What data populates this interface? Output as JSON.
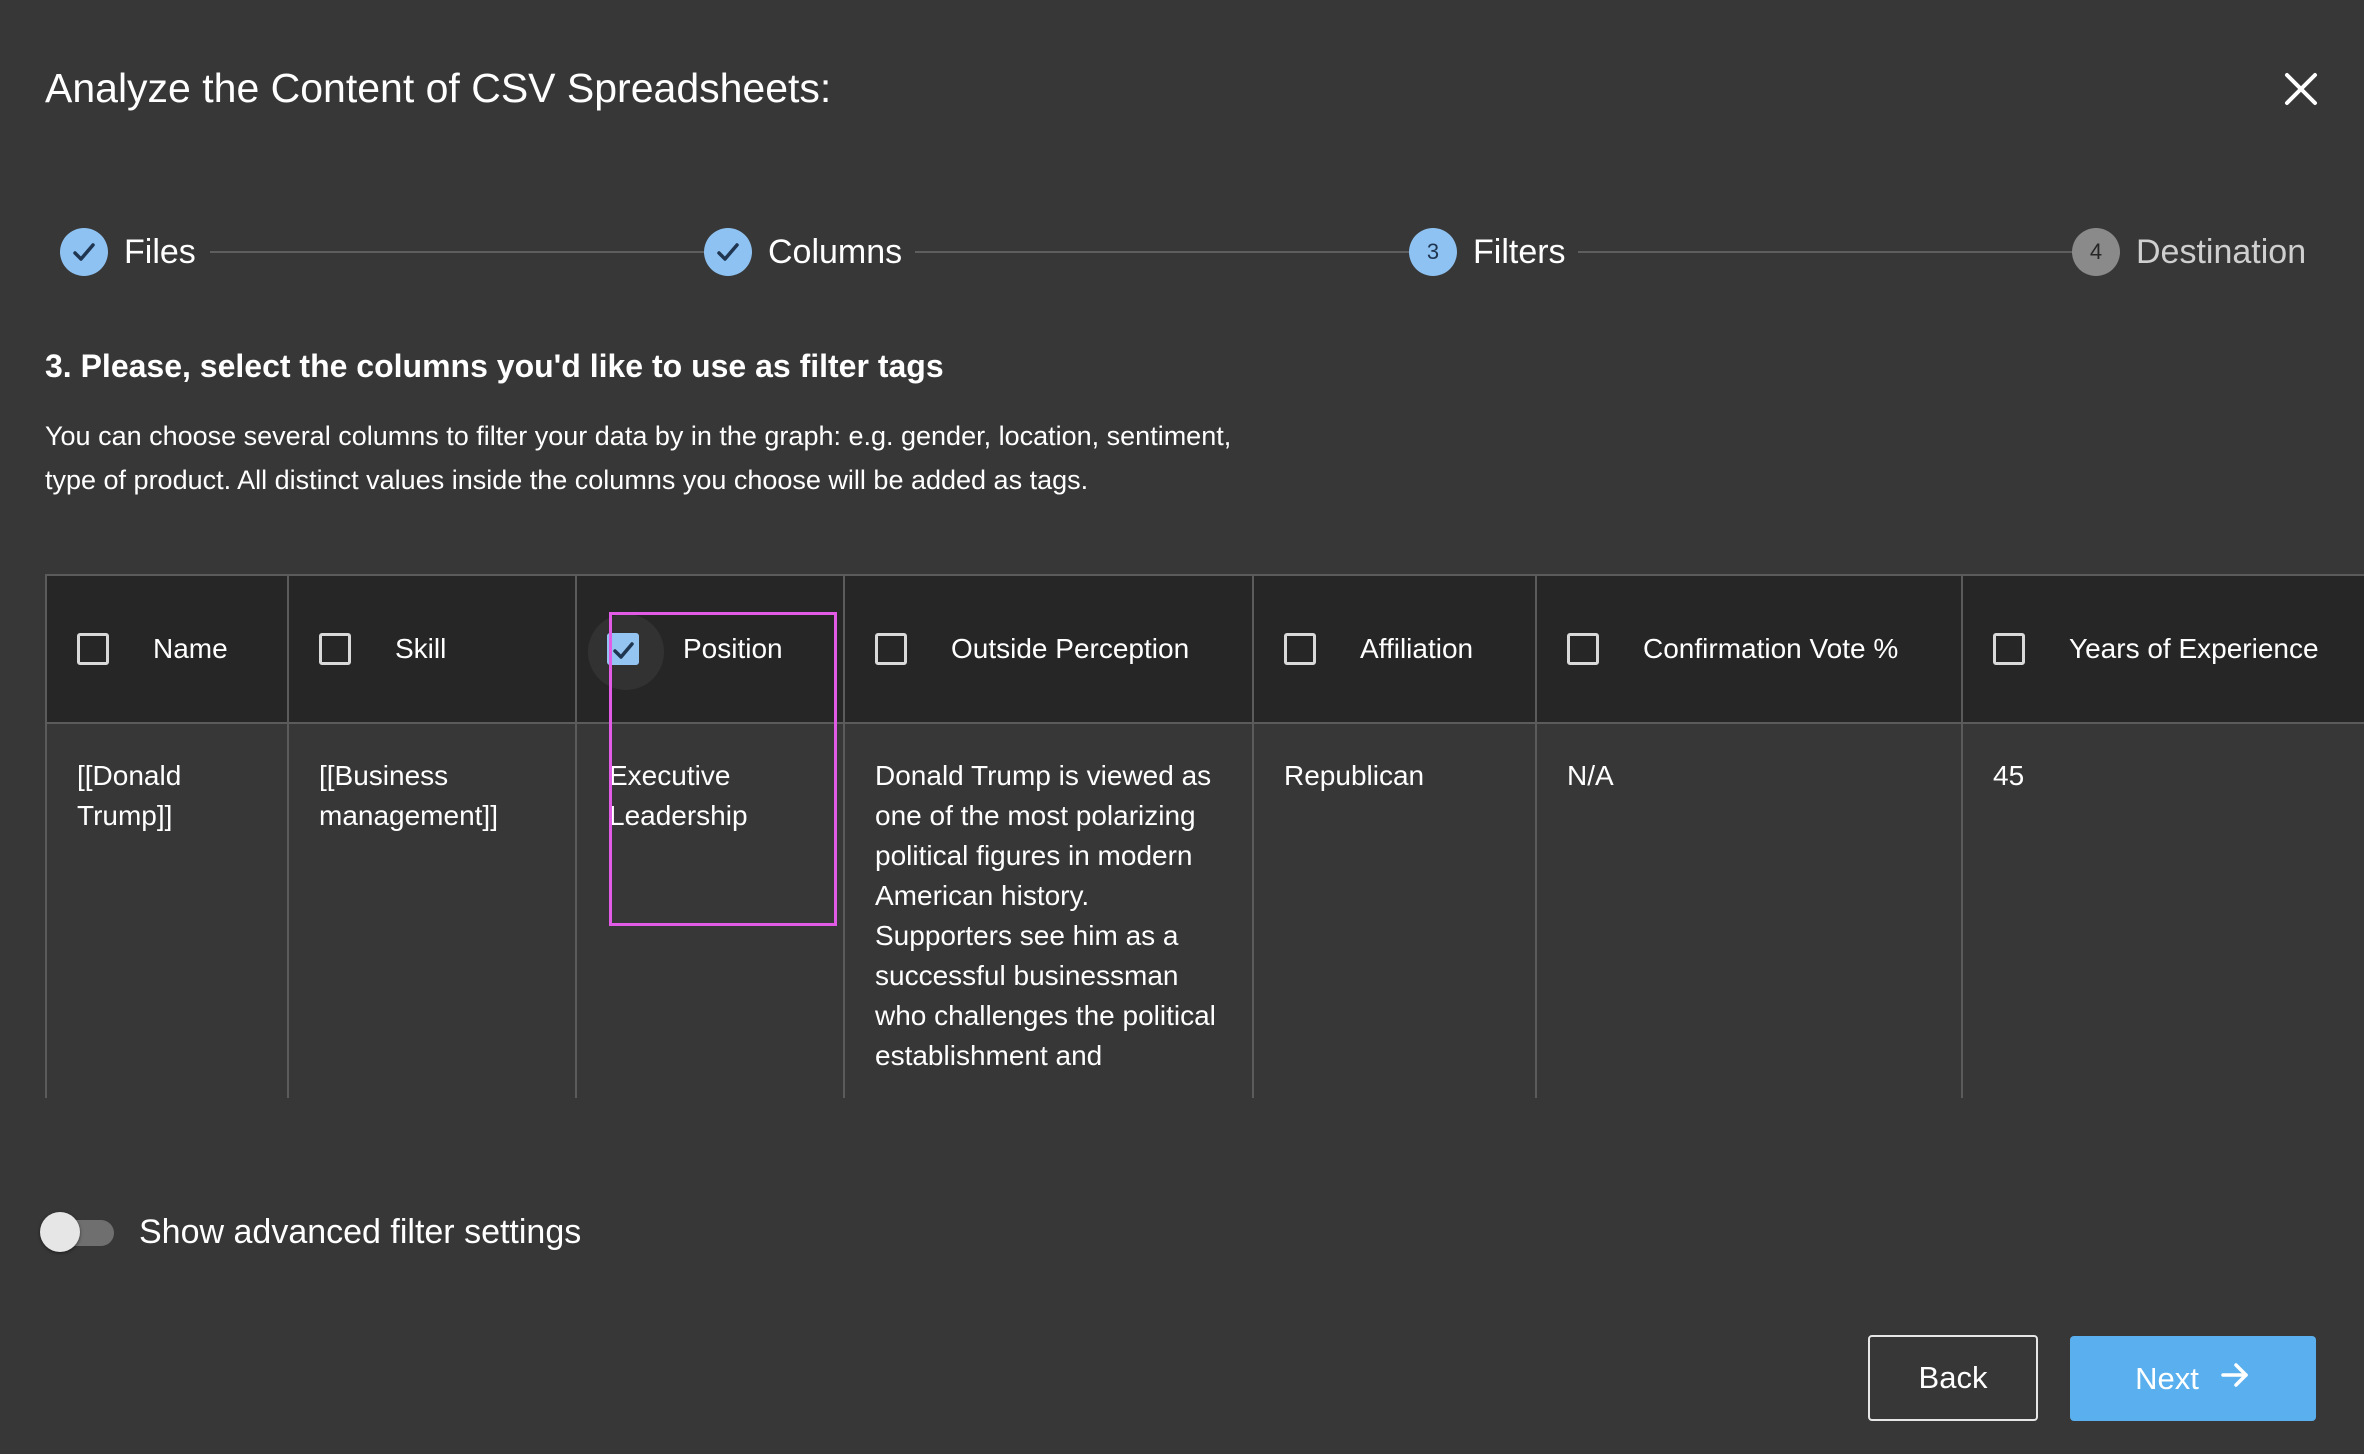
{
  "dialog": {
    "title": "Analyze the Content of CSV Spreadsheets:"
  },
  "stepper": {
    "steps": [
      {
        "label": "Files",
        "state": "done",
        "number": ""
      },
      {
        "label": "Columns",
        "state": "done",
        "number": ""
      },
      {
        "label": "Filters",
        "state": "active",
        "number": "3"
      },
      {
        "label": "Destination",
        "state": "todo",
        "number": "4"
      }
    ]
  },
  "section": {
    "heading": "3. Please, select the columns you'd like to use as filter tags",
    "description": "You can choose several columns to filter your data by in the graph: e.g. gender, location, sentiment, type of product. All distinct values inside the columns you choose will be added as tags."
  },
  "table": {
    "columns": [
      {
        "label": "Name",
        "checked": false
      },
      {
        "label": "Skill",
        "checked": false
      },
      {
        "label": "Position",
        "checked": true
      },
      {
        "label": "Outside Perception",
        "checked": false
      },
      {
        "label": "Affiliation",
        "checked": false
      },
      {
        "label": "Confirmation Vote %",
        "checked": false
      },
      {
        "label": "Years of Experience",
        "checked": false
      }
    ],
    "rows": [
      [
        "[[Donald Trump]]",
        "[[Business management]]",
        "Executive Leadership",
        "Donald Trump is viewed as one of the most polarizing political figures in modern American history. Supporters see him as a successful businessman who challenges the political establishment and",
        "Republican",
        "N/A",
        "45"
      ]
    ]
  },
  "advanced": {
    "label": "Show advanced filter settings",
    "enabled": false
  },
  "footer": {
    "back_label": "Back",
    "next_label": "Next"
  },
  "colors": {
    "background": "#373737",
    "header_background": "#262626",
    "accent": "#5ab0ee",
    "step_done": "#8ec2f2",
    "highlight": "#e25be6"
  },
  "icons": {
    "close": "close-icon",
    "check": "check-icon",
    "next_arrow": "arrow-right-icon"
  }
}
